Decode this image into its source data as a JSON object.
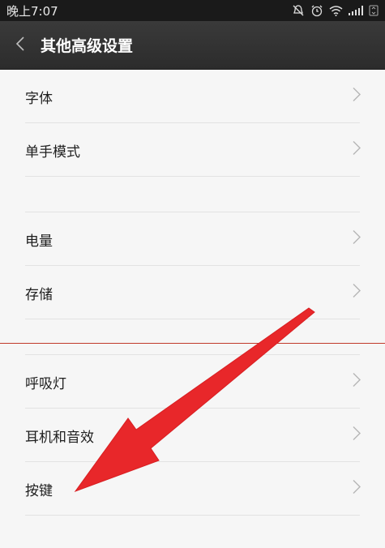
{
  "status_bar": {
    "time": "晚上7:07",
    "icons": [
      "mute-icon",
      "alarm-icon",
      "wifi-icon",
      "signal-icon",
      "3g-icon"
    ]
  },
  "header": {
    "title": "其他高级设置",
    "back_icon": "back-chevron-icon"
  },
  "settings": {
    "group1": [
      {
        "label": "字体"
      },
      {
        "label": "单手模式"
      }
    ],
    "group2": [
      {
        "label": "电量"
      },
      {
        "label": "存储"
      }
    ],
    "group3": [
      {
        "label": "呼吸灯"
      },
      {
        "label": "耳机和音效"
      },
      {
        "label": "按键"
      }
    ]
  },
  "colors": {
    "arrow": "#e8272a",
    "divider_accent": "#c0392b",
    "header_bg": "#333333"
  }
}
